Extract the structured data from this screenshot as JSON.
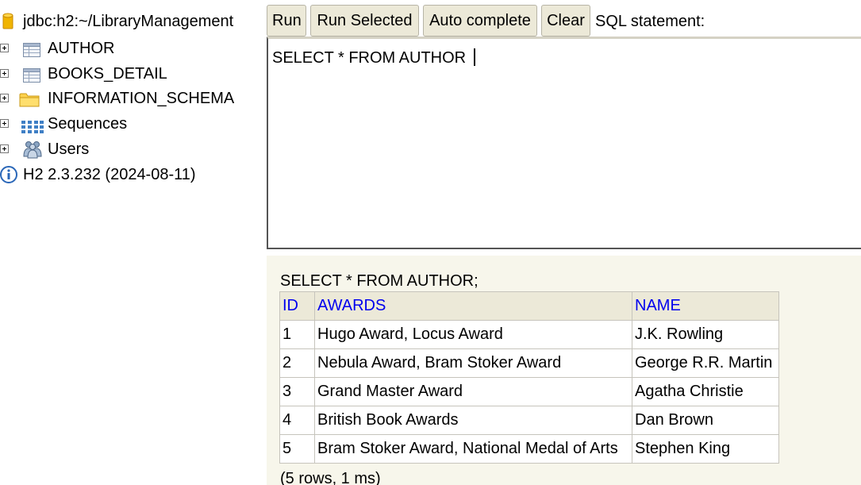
{
  "tree": {
    "connection": "jdbc:h2:~/LibraryManagement",
    "items": [
      {
        "label": "AUTHOR",
        "icon": "table-icon"
      },
      {
        "label": "BOOKS_DETAIL",
        "icon": "table-icon"
      },
      {
        "label": "INFORMATION_SCHEMA",
        "icon": "folder-icon"
      },
      {
        "label": "Sequences",
        "icon": "sequences-icon"
      },
      {
        "label": "Users",
        "icon": "users-icon"
      }
    ],
    "version": "H2 2.3.232 (2024-08-11)"
  },
  "toolbar": {
    "run": "Run",
    "run_selected": "Run Selected",
    "auto_complete": "Auto complete",
    "clear": "Clear",
    "sql_label": "SQL statement:"
  },
  "editor": {
    "value": "SELECT * FROM AUTHOR "
  },
  "result": {
    "query": "SELECT * FROM AUTHOR;",
    "columns": [
      "ID",
      "AWARDS",
      "NAME"
    ],
    "rows": [
      [
        "1",
        "Hugo Award, Locus Award",
        "J.K. Rowling"
      ],
      [
        "2",
        "Nebula Award, Bram Stoker Award",
        "George R.R. Martin"
      ],
      [
        "3",
        "Grand Master Award",
        "Agatha Christie"
      ],
      [
        "4",
        "British Book Awards",
        "Dan Brown"
      ],
      [
        "5",
        "Bram Stoker Award, National Medal of Arts",
        "Stephen King"
      ]
    ],
    "status": "(5 rows, 1 ms)"
  },
  "colors": {
    "header_link": "#0000ee",
    "button_bg": "#ece9d8",
    "result_bg": "#f7f6eb"
  }
}
